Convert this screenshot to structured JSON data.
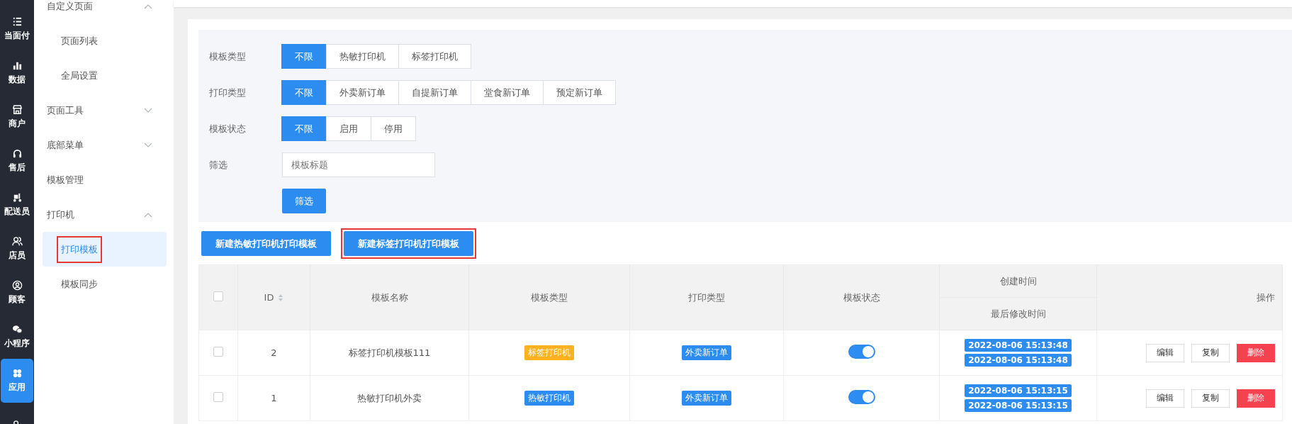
{
  "rail": [
    {
      "label": "当面付",
      "selected": false
    },
    {
      "label": "数据",
      "selected": false
    },
    {
      "label": "商户",
      "selected": false
    },
    {
      "label": "售后",
      "selected": false
    },
    {
      "label": "配送员",
      "selected": false
    },
    {
      "label": "店员",
      "selected": false
    },
    {
      "label": "顾客",
      "selected": false
    },
    {
      "label": "小程序",
      "selected": false
    },
    {
      "label": "应用",
      "selected": true
    },
    {
      "selected": false
    }
  ],
  "sidebar": {
    "items": [
      {
        "label": "自定义页面",
        "expanded": true,
        "children": [
          {
            "label": "页面列表",
            "selected": false,
            "highlighted": false
          },
          {
            "label": "全局设置",
            "selected": false,
            "highlighted": false
          }
        ]
      },
      {
        "label": "页面工具",
        "expanded": false
      },
      {
        "label": "底部菜单",
        "expanded": false
      },
      {
        "label": "模板管理"
      },
      {
        "label": "打印机",
        "expanded": true,
        "children": [
          {
            "label": "打印模板",
            "selected": true,
            "highlighted": true
          },
          {
            "label": "模板同步",
            "selected": false,
            "highlighted": false
          }
        ]
      }
    ]
  },
  "filters": [
    {
      "label": "模板类型",
      "options": [
        {
          "label": "不限",
          "selected": true
        },
        {
          "label": "热敏打印机",
          "selected": false
        },
        {
          "label": "标签打印机",
          "selected": false
        }
      ]
    },
    {
      "label": "打印类型",
      "options": [
        {
          "label": "不限",
          "selected": true
        },
        {
          "label": "外卖新订单",
          "selected": false
        },
        {
          "label": "自提新订单",
          "selected": false
        },
        {
          "label": "堂食新订单",
          "selected": false
        },
        {
          "label": "预定新订单",
          "selected": false
        }
      ]
    },
    {
      "label": "模板状态",
      "options": [
        {
          "label": "不限",
          "selected": true
        },
        {
          "label": "启用",
          "selected": false
        },
        {
          "label": "停用",
          "selected": false
        }
      ]
    }
  ],
  "search": {
    "label": "筛选",
    "placeholder": "模板标题",
    "button": "筛选"
  },
  "actions": [
    {
      "label": "新建热敏打印机打印模板",
      "highlighted": false
    },
    {
      "label": "新建标签打印机打印模板",
      "highlighted": true
    }
  ],
  "table": {
    "header_checked": false,
    "columns": {
      "id": "ID",
      "name": "模板名称",
      "type": "模板类型",
      "print": "打印类型",
      "status": "模板状态",
      "created": "创建时间",
      "modified": "最后修改时间",
      "ops": "操作"
    },
    "rows": [
      {
        "checked": false,
        "id": "2",
        "name": "标签打印机模板111",
        "type": {
          "label": "标签打印机",
          "color": "#fbb121"
        },
        "print": {
          "label": "外卖新订单",
          "color": "#2d8cf0"
        },
        "on": true,
        "created": "2022-08-06 15:13:48",
        "modified": "2022-08-06 15:13:48",
        "buttons": [
          "编辑",
          "复制",
          "删除"
        ]
      },
      {
        "checked": false,
        "id": "1",
        "name": "热敏打印机外卖",
        "type": {
          "label": "热敏打印机",
          "color": "#2d8cf0"
        },
        "print": {
          "label": "外卖新订单",
          "color": "#2d8cf0"
        },
        "on": true,
        "created": "2022-08-06 15:13:15",
        "modified": "2022-08-06 15:13:15",
        "buttons": [
          "编辑",
          "复制",
          "删除"
        ]
      }
    ]
  }
}
